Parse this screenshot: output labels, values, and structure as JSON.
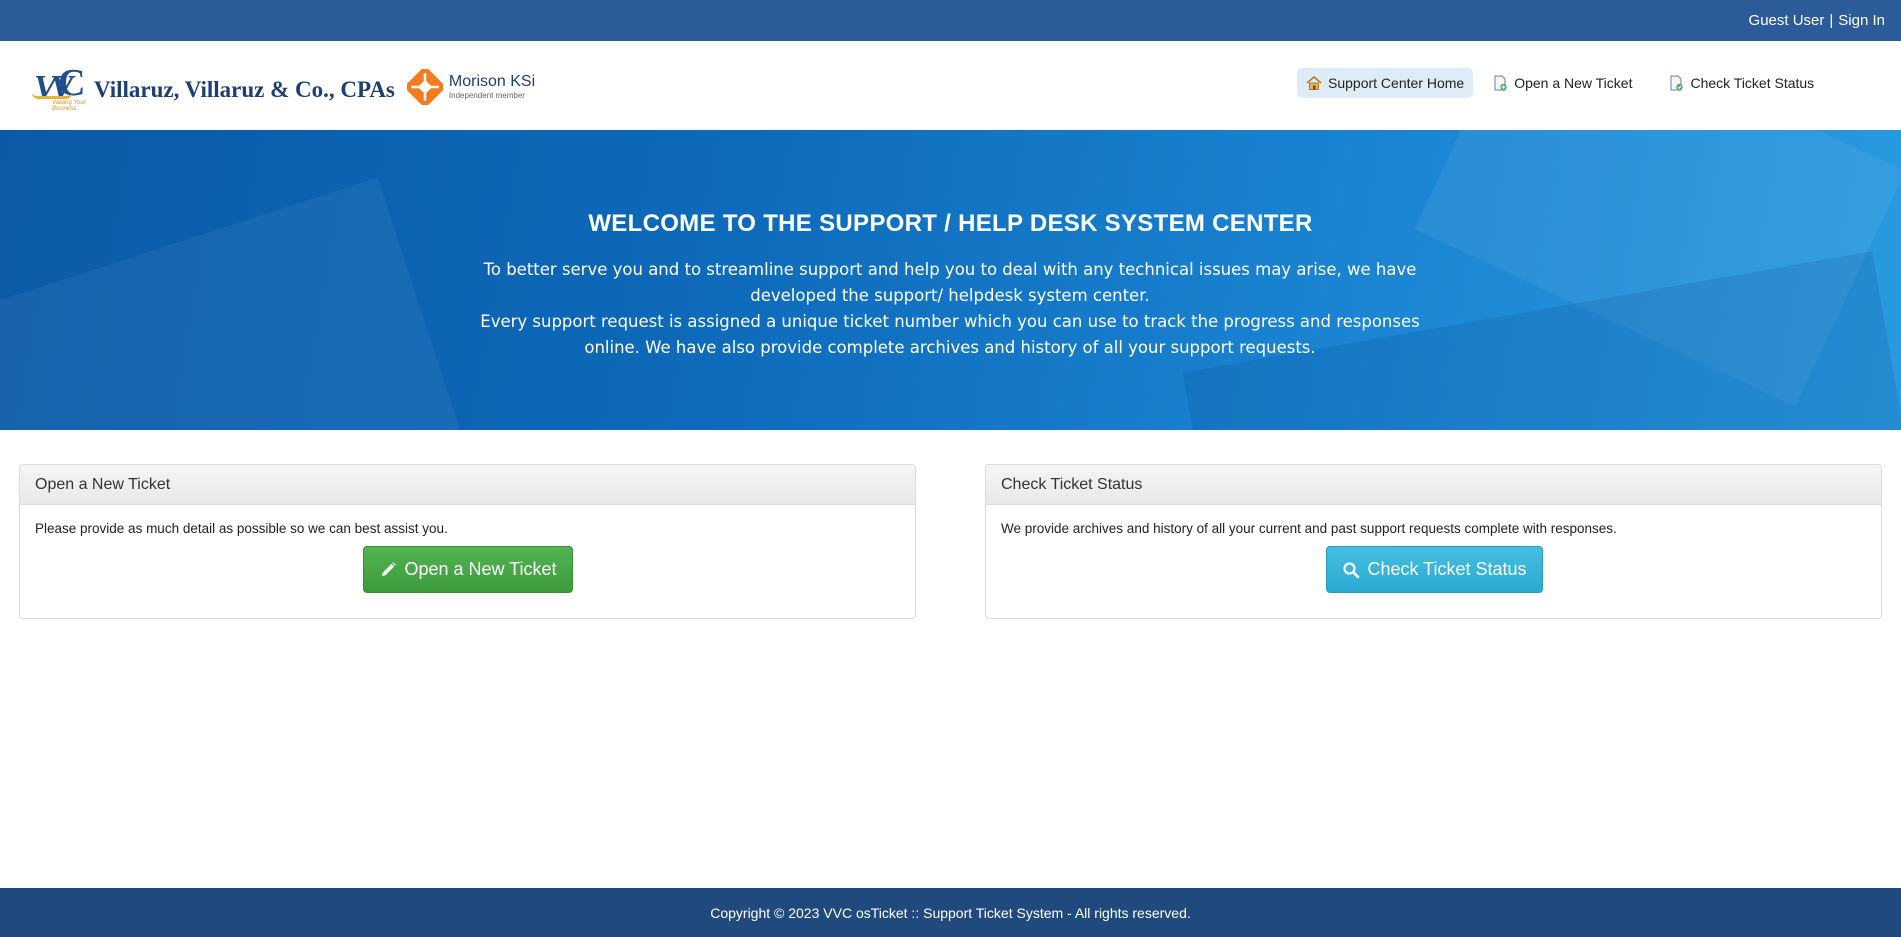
{
  "topbar": {
    "guest_label": "Guest User",
    "separator": "|",
    "signin_label": "Sign In"
  },
  "header": {
    "logo_tagline": "Valuing Your Business",
    "firm_name": "Villaruz, Villaruz & Co., CPAs",
    "partner_name": "Morison KSi",
    "partner_sub": "Independent member",
    "nav": [
      {
        "label": "Support Center Home",
        "icon": "home-icon",
        "active": true
      },
      {
        "label": "Open a New Ticket",
        "icon": "new-ticket-icon",
        "active": false
      },
      {
        "label": "Check Ticket Status",
        "icon": "ticket-status-icon",
        "active": false
      }
    ]
  },
  "hero": {
    "title": "WELCOME TO THE SUPPORT / HELP DESK SYSTEM CENTER",
    "paragraph1": "To better serve you and to streamline support and help you to deal with any technical issues may arise, we have developed the support/ helpdesk system center.",
    "paragraph2": "Every support request is assigned a unique ticket number which you can use to track the progress and responses online. We have also provide complete archives and history of all your support requests."
  },
  "panels": {
    "open": {
      "title": "Open a New Ticket",
      "text": "Please provide as much detail as possible so we can best assist you.",
      "button": "Open a New Ticket",
      "button_icon": "pencil-icon"
    },
    "check": {
      "title": "Check Ticket Status",
      "text": "We provide archives and history of all your current and past support requests complete with responses.",
      "button": "Check Ticket Status",
      "button_icon": "search-icon"
    }
  },
  "footer": {
    "copyright": "Copyright © 2023 VVC osTicket :: Support Ticket System - All rights reserved."
  },
  "colors": {
    "topbar": "#2b5c99",
    "footer": "#204a7d",
    "hero_start": "#0c5aa7",
    "hero_end": "#2a9ae0",
    "success_button": "#4cae4c",
    "info_button": "#39b3d7",
    "nav_active": "#ddecf7"
  }
}
